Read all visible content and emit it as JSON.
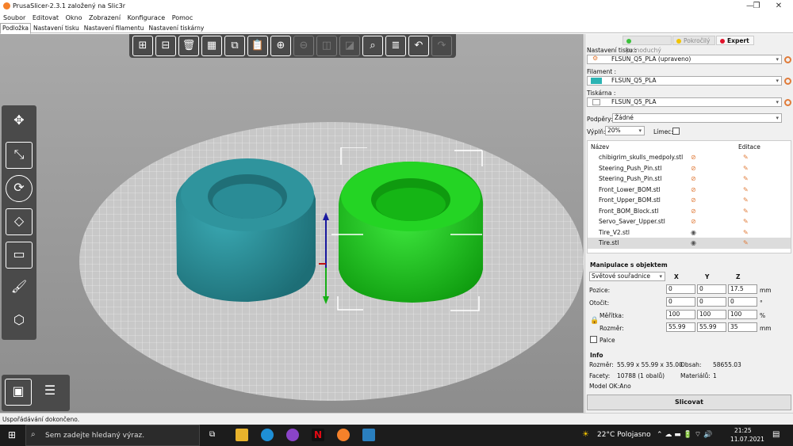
{
  "window": {
    "title": "PrusaSlicer-2.3.1 založený na Slic3r",
    "minimize": "—",
    "maximize": "❐",
    "close": "✕"
  },
  "menu": [
    "Soubor",
    "Editovat",
    "Okno",
    "Zobrazení",
    "Konfigurace",
    "Pomoc"
  ],
  "tabs": [
    "Podložka",
    "Nastavení tisku",
    "Nastavení filamentu",
    "Nastavení tiskárny"
  ],
  "modes": [
    {
      "label": "Jednoduchý",
      "color": "#3cc13c"
    },
    {
      "label": "Pokročilý",
      "color": "#f2c400"
    },
    {
      "label": "Expert",
      "color": "#e0142c"
    }
  ],
  "print_settings": {
    "label": "Nastavení tisku :",
    "value": "FLSUN_Q5_PLA (upraveno)"
  },
  "filament": {
    "label": "Filament :",
    "value": "FLSUN_Q5_PLA",
    "color": "#2bb3b3"
  },
  "printer": {
    "label": "Tiskárna :",
    "value": "FLSUN_Q5_PLA"
  },
  "supports": {
    "label": "Podpěry:",
    "value": "Žádné"
  },
  "infill": {
    "label": "Výplň:",
    "value": "20%"
  },
  "brim": {
    "label": "Límec:"
  },
  "object_list": {
    "col_name": "Název",
    "col_edit": "Editace",
    "items": [
      {
        "name": "chibigrim_skulls_medpoly.stl",
        "visible": false
      },
      {
        "name": "Steering_Push_Pin.stl",
        "visible": false
      },
      {
        "name": "Steering_Push_Pin.stl",
        "visible": false
      },
      {
        "name": "Front_Lower_BOM.stl",
        "visible": false
      },
      {
        "name": "Front_Upper_BOM.stl",
        "visible": false
      },
      {
        "name": "Front_BOM_Block.stl",
        "visible": false
      },
      {
        "name": "Servo_Saver_Upper.stl",
        "visible": false
      },
      {
        "name": "Tire_V2.stl",
        "visible": true
      },
      {
        "name": "Tire.stl",
        "visible": true,
        "selected": true
      }
    ]
  },
  "manipulation": {
    "title": "Manipulace s objektem",
    "coord_system": "Světové souřadnice",
    "axes": [
      "X",
      "Y",
      "Z"
    ],
    "position": {
      "label": "Pozice:",
      "values": [
        "0",
        "0",
        "17.5"
      ],
      "unit": "mm"
    },
    "rotation": {
      "label": "Otočit:",
      "values": [
        "0",
        "0",
        "0"
      ],
      "unit": "°"
    },
    "scale": {
      "label": "Měřítka:",
      "values": [
        "100",
        "100",
        "100"
      ],
      "unit": "%"
    },
    "size": {
      "label": "Rozměr:",
      "values": [
        "55.99",
        "55.99",
        "35"
      ],
      "unit": "mm"
    },
    "inches": "Palce"
  },
  "info": {
    "title": "Info",
    "size_label": "Rozměr:",
    "size_value": "55.99 x 55.99 x 35.00",
    "volume_label": "Obsah:",
    "volume_value": "58655.03",
    "facets_label": "Facety:",
    "facets_value": "10788 (1 obalů)",
    "materials_label": "Materiálů:",
    "materials_value": "1",
    "model_ok": "Model OK:Ano"
  },
  "slice_button": "Slicovat",
  "status": "Uspořádávání dokončeno.",
  "taskbar": {
    "search_placeholder": "Sem zadejte hledaný výraz.",
    "weather": "22°C Polojasno",
    "time": "21:25",
    "date": "11.07.2021"
  },
  "colors": {
    "tire_left": "#2a8c96",
    "tire_right": "#15c515",
    "accent": "#e07b39"
  }
}
